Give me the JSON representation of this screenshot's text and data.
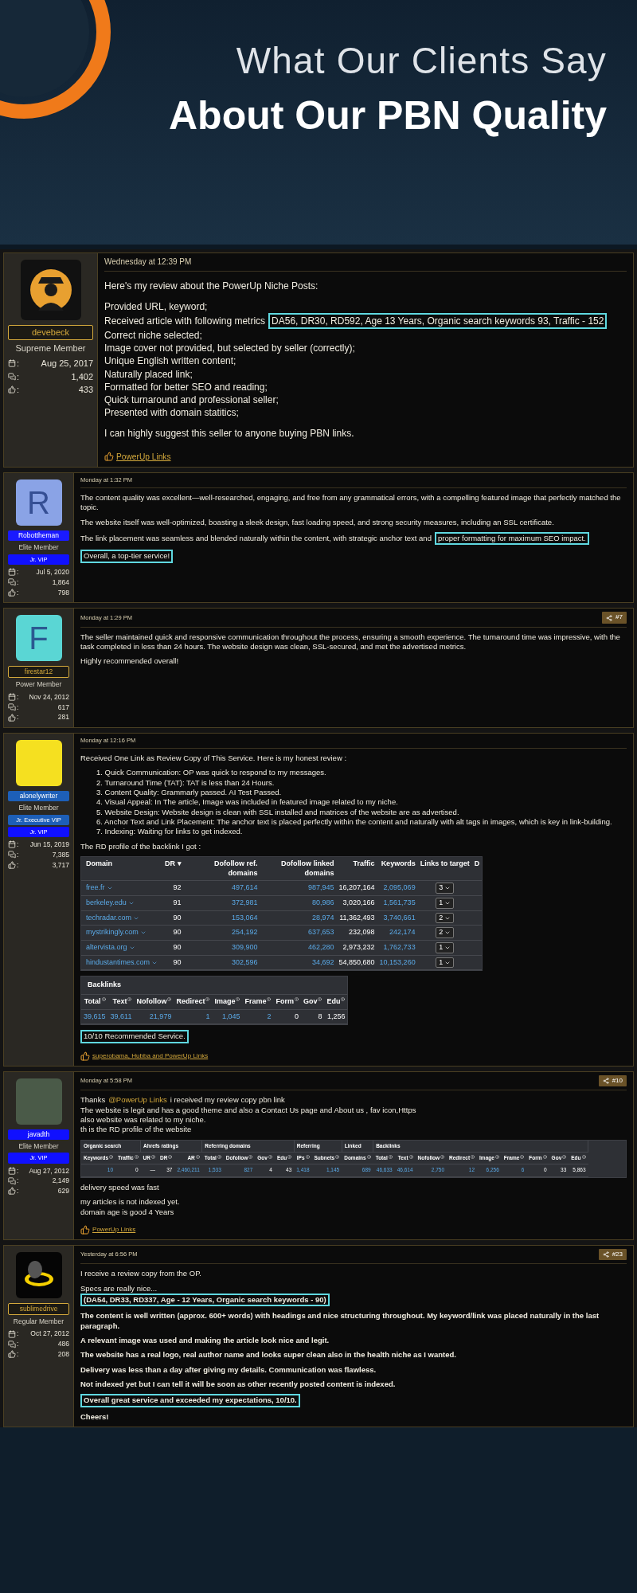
{
  "banner": {
    "line1": "What Our Clients Say",
    "line2": "About Our PBN Quality"
  },
  "posts": [
    {
      "user": {
        "avatar": {
          "kind": "silhouette",
          "color": "#111111"
        },
        "tag": {
          "text": "devebeck",
          "kind": "outlined",
          "color": "#d4a93c"
        },
        "role": "Supreme Member",
        "stats": [
          {
            "kind": "joined",
            "label": ":",
            "value": "Aug 25, 2017"
          },
          {
            "kind": "messages",
            "label": ":",
            "value": "1,402"
          },
          {
            "kind": "reactions",
            "label": ":",
            "value": "433"
          }
        ]
      },
      "date": "Wednesday at 12:39 PM",
      "blocks": [
        {
          "kind": "para",
          "lines": [
            {
              "bold": false,
              "parts": [
                {
                  "text": "Here's my review about the PowerUp Niche Posts:",
                  "kind": "plain"
                }
              ]
            }
          ]
        },
        {
          "kind": "para",
          "lines": [
            {
              "bold": false,
              "parts": [
                {
                  "text": "Provided URL, keyword;",
                  "kind": "plain"
                }
              ]
            },
            {
              "bold": false,
              "parts": [
                {
                  "text": "Received article with following metrics",
                  "kind": "plain"
                },
                {
                  "text": "DA56, DR30, RD592, Age 13 Years, Organic search keywords 93, Traffic - 152",
                  "kind": "boxed"
                }
              ]
            },
            {
              "bold": false,
              "parts": [
                {
                  "text": "Correct niche selected;",
                  "kind": "plain"
                }
              ]
            },
            {
              "bold": false,
              "parts": [
                {
                  "text": "Image cover not provided, but selected by seller (correctly);",
                  "kind": "plain"
                }
              ]
            },
            {
              "bold": false,
              "parts": [
                {
                  "text": "Unique English written content;",
                  "kind": "plain"
                }
              ]
            },
            {
              "bold": false,
              "parts": [
                {
                  "text": "Naturally placed link;",
                  "kind": "plain"
                }
              ]
            },
            {
              "bold": false,
              "parts": [
                {
                  "text": "Formatted for better SEO and reading;",
                  "kind": "plain"
                }
              ]
            },
            {
              "bold": false,
              "parts": [
                {
                  "text": "Quick turnaround and professional seller;",
                  "kind": "plain"
                }
              ]
            },
            {
              "bold": false,
              "parts": [
                {
                  "text": "Presented with domain statitics;",
                  "kind": "plain"
                }
              ]
            }
          ]
        },
        {
          "kind": "para",
          "lines": [
            {
              "bold": false,
              "parts": [
                {
                  "text": "I can highly suggest this seller to anyone buying PBN links.",
                  "kind": "plain"
                }
              ]
            }
          ]
        },
        {
          "kind": "likes",
          "text": "PowerUp Links"
        }
      ]
    },
    {
      "user": {
        "avatar": {
          "kind": "letter",
          "letter": "R",
          "color": "#8aa3e6"
        },
        "tag": {
          "text": "Robottheman",
          "kind": "filled",
          "color": "#1a1aff"
        },
        "role": "Elite Member",
        "badges": [
          {
            "text": "Jr. VIP",
            "color": "#1010ff"
          }
        ],
        "stats": [
          {
            "kind": "joined",
            "label": ":",
            "value": "Jul 5, 2020"
          },
          {
            "kind": "messages",
            "label": ":",
            "value": "1,864"
          },
          {
            "kind": "reactions",
            "label": ":",
            "value": "798"
          }
        ]
      },
      "date": "Monday at 1:32 PM",
      "blocks": [
        {
          "kind": "para",
          "lines": [
            {
              "bold": false,
              "parts": [
                {
                  "text": "The content quality was excellent—well-researched, engaging, and free from any grammatical errors, with a compelling featured image that perfectly matched the topic.",
                  "kind": "plain"
                }
              ]
            }
          ]
        },
        {
          "kind": "para",
          "lines": [
            {
              "bold": false,
              "parts": [
                {
                  "text": "The website itself was well-optimized, boasting a sleek design, fast loading speed, and strong security measures, including an SSL certificate.",
                  "kind": "plain"
                }
              ]
            }
          ]
        },
        {
          "kind": "para",
          "lines": [
            {
              "bold": false,
              "parts": [
                {
                  "text": "The link placement was seamless and blended naturally within the content, with strategic anchor text and",
                  "kind": "plain"
                },
                {
                  "text": "proper formatting for maximum SEO impact.",
                  "kind": "boxed"
                }
              ]
            }
          ]
        },
        {
          "kind": "para",
          "lines": [
            {
              "bold": false,
              "parts": [
                {
                  "text": "Overall, a top-tier service!",
                  "kind": "boxed"
                }
              ]
            }
          ]
        }
      ]
    },
    {
      "user": {
        "avatar": {
          "kind": "letter",
          "letter": "F",
          "color": "#5ad6d4"
        },
        "tag": {
          "text": "firestar12",
          "kind": "outlined",
          "color": "#d4a93c"
        },
        "role": "Power Member",
        "stats": [
          {
            "kind": "joined",
            "label": ":",
            "value": "Nov 24, 2012"
          },
          {
            "kind": "messages",
            "label": ":",
            "value": "617"
          },
          {
            "kind": "reactions",
            "label": ":",
            "value": "281"
          }
        ]
      },
      "date": "Monday at 1:29 PM",
      "number": "#7",
      "blocks": [
        {
          "kind": "para",
          "lines": [
            {
              "bold": false,
              "parts": [
                {
                  "text": "The seller maintained quick and responsive communication throughout the process, ensuring a smooth experience. The turnaround time was impressive, with the task completed in less than 24 hours. The website design was clean, SSL-secured, and met the advertised metrics.",
                  "kind": "plain"
                }
              ]
            }
          ]
        },
        {
          "kind": "para",
          "lines": [
            {
              "bold": false,
              "parts": [
                {
                  "text": "Highly recommended overall!",
                  "kind": "plain"
                }
              ]
            }
          ]
        }
      ]
    },
    {
      "user": {
        "avatar": {
          "kind": "photo",
          "color": "#f5e020"
        },
        "tag": {
          "text": "alonelywriter",
          "kind": "filled",
          "color": "#1d5fb8"
        },
        "role": "Elite Member",
        "badges": [
          {
            "text": "Jr. Executive VIP",
            "color": "#1d5fb8"
          },
          {
            "text": "Jr. VIP",
            "color": "#1010ff"
          }
        ],
        "stats": [
          {
            "kind": "joined",
            "label": ":",
            "value": "Jun 15, 2019"
          },
          {
            "kind": "messages",
            "label": ":",
            "value": "7,385"
          },
          {
            "kind": "reactions",
            "label": ":",
            "value": "3,717"
          }
        ]
      },
      "date": "Monday at 12:16 PM",
      "blocks": [
        {
          "kind": "para",
          "lines": [
            {
              "bold": false,
              "parts": [
                {
                  "text": "Received One Link as Review Copy of This Service. Here is my honest review :",
                  "kind": "plain"
                }
              ]
            }
          ]
        },
        {
          "kind": "list",
          "items": [
            "1. Quick Communication: OP was quick to respond to my messages.",
            "2. Turnaround Time (TAT): TAT is less than 24 Hours.",
            "3. Content Quality: Grammarly passed. AI Test Passed.",
            "4. Visual Appeal: In The article, Image was included in featured image related to my niche.",
            "5. Website Design: Website design is clean with SSL installed and matrices of the website are as advertised.",
            "6. Anchor Text and Link Placement: The anchor text is placed perfectly within the content and naturally with alt tags in images, which is key in link-building.",
            "7. Indexing: Waiting for links to get indexed."
          ]
        },
        {
          "kind": "para",
          "lines": [
            {
              "bold": false,
              "parts": [
                {
                  "text": "The RD profile of the backlink I got :",
                  "kind": "plain"
                }
              ]
            }
          ]
        },
        {
          "kind": "table",
          "info_marks": false,
          "columns": [
            "Domain",
            "DR ▾",
            "Dofollow ref. domains",
            "Dofollow linked domains",
            "Traffic",
            "Keywords",
            "Links to target",
            "D"
          ],
          "rows": [
            [
              {
                "text": "free.fr",
                "kind": "domain"
              },
              {
                "text": "92",
                "kind": "plain"
              },
              {
                "text": "497,614",
                "kind": "link"
              },
              {
                "text": "987,945",
                "kind": "link"
              },
              {
                "text": "16,207,164",
                "kind": "plain"
              },
              {
                "text": "2,095,069",
                "kind": "link"
              },
              {
                "text": "3",
                "kind": "select"
              }
            ],
            [
              {
                "text": "berkeley.edu",
                "kind": "domain"
              },
              {
                "text": "91",
                "kind": "plain"
              },
              {
                "text": "372,981",
                "kind": "link"
              },
              {
                "text": "80,986",
                "kind": "link"
              },
              {
                "text": "3,020,166",
                "kind": "plain"
              },
              {
                "text": "1,561,735",
                "kind": "link"
              },
              {
                "text": "1",
                "kind": "select"
              }
            ],
            [
              {
                "text": "techradar.com",
                "kind": "domain"
              },
              {
                "text": "90",
                "kind": "plain"
              },
              {
                "text": "153,064",
                "kind": "link"
              },
              {
                "text": "28,974",
                "kind": "link"
              },
              {
                "text": "11,362,493",
                "kind": "plain"
              },
              {
                "text": "3,740,661",
                "kind": "link"
              },
              {
                "text": "2",
                "kind": "select"
              }
            ],
            [
              {
                "text": "mystrikingly.com",
                "kind": "domain"
              },
              {
                "text": "90",
                "kind": "plain"
              },
              {
                "text": "254,192",
                "kind": "link"
              },
              {
                "text": "637,653",
                "kind": "link"
              },
              {
                "text": "232,098",
                "kind": "plain"
              },
              {
                "text": "242,174",
                "kind": "link"
              },
              {
                "text": "2",
                "kind": "select"
              }
            ],
            [
              {
                "text": "altervista.org",
                "kind": "domain"
              },
              {
                "text": "90",
                "kind": "plain"
              },
              {
                "text": "309,900",
                "kind": "link"
              },
              {
                "text": "462,280",
                "kind": "link"
              },
              {
                "text": "2,973,232",
                "kind": "plain"
              },
              {
                "text": "1,762,733",
                "kind": "link"
              },
              {
                "text": "1",
                "kind": "select"
              }
            ],
            [
              {
                "text": "hindustantimes.com",
                "kind": "domain"
              },
              {
                "text": "90",
                "kind": "plain"
              },
              {
                "text": "302,596",
                "kind": "link"
              },
              {
                "text": "34,692",
                "kind": "link"
              },
              {
                "text": "54,850,680",
                "kind": "plain"
              },
              {
                "text": "10,153,260",
                "kind": "link"
              },
              {
                "text": "1",
                "kind": "select"
              }
            ]
          ]
        },
        {
          "kind": "table",
          "title": "Backlinks",
          "info_marks": true,
          "columns": [
            "Total",
            "Text",
            "Nofollow",
            "Redirect",
            "Image",
            "Frame",
            "Form",
            "Gov",
            "Edu"
          ],
          "rows": [
            [
              {
                "text": "39,615",
                "kind": "link"
              },
              {
                "text": "39,611",
                "kind": "link"
              },
              {
                "text": "21,979",
                "kind": "link"
              },
              {
                "text": "1",
                "kind": "link"
              },
              {
                "text": "1,045",
                "kind": "link"
              },
              {
                "text": "2",
                "kind": "link"
              },
              {
                "text": "0",
                "kind": "plain"
              },
              {
                "text": "8",
                "kind": "plain"
              },
              {
                "text": "1,256",
                "kind": "plain"
              }
            ]
          ]
        },
        {
          "kind": "para",
          "lines": [
            {
              "bold": false,
              "parts": [
                {
                  "text": "10/10 Recommended Service.",
                  "kind": "boxed"
                }
              ]
            }
          ]
        },
        {
          "kind": "likes",
          "text": "superobama, Hubba and PowerUp Links"
        }
      ]
    },
    {
      "user": {
        "avatar": {
          "kind": "photo",
          "color": "#4a5a48"
        },
        "tag": {
          "text": "javadth",
          "kind": "filled",
          "color": "#1010ff"
        },
        "role": "Elite Member",
        "badges": [
          {
            "text": "Jr. VIP",
            "color": "#1010ff"
          }
        ],
        "stats": [
          {
            "kind": "joined",
            "label": ":",
            "value": "Aug 27, 2012"
          },
          {
            "kind": "messages",
            "label": ":",
            "value": "2,149"
          },
          {
            "kind": "reactions",
            "label": ":",
            "value": "629"
          }
        ]
      },
      "date": "Monday at 5:58 PM",
      "number": "#10",
      "blocks": [
        {
          "kind": "para",
          "lines": [
            {
              "bold": false,
              "parts": [
                {
                  "text": "Thanks",
                  "kind": "plain"
                },
                {
                  "text": "@PowerUp Links",
                  "kind": "mention"
                },
                {
                  "text": "i received my review copy pbn link",
                  "kind": "plain"
                }
              ]
            },
            {
              "bold": false,
              "parts": [
                {
                  "text": "The website is legit and has a good theme and also a Contact Us page and About us , fav icon,Https",
                  "kind": "plain"
                }
              ]
            },
            {
              "bold": false,
              "parts": [
                {
                  "text": "also website was related to my niche.",
                  "kind": "plain"
                }
              ]
            },
            {
              "bold": false,
              "parts": [
                {
                  "text": "th is the RD profile of the website",
                  "kind": "plain"
                }
              ]
            }
          ]
        },
        {
          "kind": "table",
          "info_marks": true,
          "groups": [
            {
              "label": "Organic search",
              "columns": [
                "Keywords",
                "Traffic"
              ]
            },
            {
              "label": "Ahrefs ratings",
              "columns": [
                "UR",
                "DR",
                "AR"
              ]
            },
            {
              "label": "Referring domains",
              "columns": [
                "Total",
                "Dofollow",
                "Gov",
                "Edu"
              ]
            },
            {
              "label": "Referring",
              "columns": [
                "IPs",
                "Subnets"
              ]
            },
            {
              "label": "Linked",
              "columns": [
                "Domains"
              ]
            },
            {
              "label": "Backlinks",
              "columns": [
                "Total",
                "Text",
                "Nofollow",
                "Redirect",
                "Image",
                "Frame",
                "Form",
                "Gov",
                "Edu"
              ]
            }
          ],
          "rows": [
            [
              {
                "text": "10",
                "kind": "link"
              },
              {
                "text": "0",
                "kind": "plain"
              },
              {
                "text": "—",
                "kind": "plain"
              },
              {
                "text": "37",
                "kind": "plain"
              },
              {
                "text": "2,460,211",
                "kind": "link"
              },
              {
                "text": "1,533",
                "kind": "link"
              },
              {
                "text": "827",
                "kind": "link"
              },
              {
                "text": "4",
                "kind": "plain"
              },
              {
                "text": "43",
                "kind": "plain"
              },
              {
                "text": "1,418",
                "kind": "link"
              },
              {
                "text": "1,145",
                "kind": "link"
              },
              {
                "text": "689",
                "kind": "link"
              },
              {
                "text": "46,633",
                "kind": "link"
              },
              {
                "text": "46,614",
                "kind": "link"
              },
              {
                "text": "2,750",
                "kind": "link"
              },
              {
                "text": "12",
                "kind": "link"
              },
              {
                "text": "6,256",
                "kind": "link"
              },
              {
                "text": "6",
                "kind": "link"
              },
              {
                "text": "0",
                "kind": "plain"
              },
              {
                "text": "33",
                "kind": "plain"
              },
              {
                "text": "5,863",
                "kind": "plain"
              }
            ]
          ]
        },
        {
          "kind": "para",
          "lines": [
            {
              "bold": false,
              "parts": [
                {
                  "text": "delivery speed was fast",
                  "kind": "plain"
                }
              ]
            }
          ]
        },
        {
          "kind": "para",
          "lines": [
            {
              "bold": false,
              "parts": [
                {
                  "text": "my articles is not indexed yet.",
                  "kind": "plain"
                }
              ]
            },
            {
              "bold": false,
              "parts": [
                {
                  "text": "domain age is good 4 Years",
                  "kind": "plain"
                }
              ]
            }
          ]
        },
        {
          "kind": "likes",
          "text": "PowerUp Links"
        }
      ]
    },
    {
      "user": {
        "avatar": {
          "kind": "ring",
          "color": "#f5d000"
        },
        "tag": {
          "text": "sublimedrive",
          "kind": "outlined",
          "color": "#d4a93c"
        },
        "role": "Regular Member",
        "stats": [
          {
            "kind": "joined",
            "label": ":",
            "value": "Oct 27, 2012"
          },
          {
            "kind": "messages",
            "label": ":",
            "value": "486"
          },
          {
            "kind": "reactions",
            "label": ":",
            "value": "208"
          }
        ]
      },
      "date": "Yesterday at 6:56 PM",
      "number": "#23",
      "blocks": [
        {
          "kind": "para",
          "lines": [
            {
              "bold": false,
              "parts": [
                {
                  "text": "I receive a review copy from the OP.",
                  "kind": "plain"
                }
              ]
            }
          ]
        },
        {
          "kind": "para",
          "lines": [
            {
              "bold": false,
              "parts": [
                {
                  "text": "Specs are really nice...",
                  "kind": "plain"
                }
              ]
            },
            {
              "bold": true,
              "parts": [
                {
                  "text": "(DA54, DR33, RD337, Age - 12 Years, Organic search keywords - 90)",
                  "kind": "boxed"
                }
              ]
            }
          ]
        },
        {
          "kind": "para",
          "lines": [
            {
              "bold": true,
              "parts": [
                {
                  "text": "The content is well written (approx. 600+ words) with headings and nice structuring throughout. My keyword/link was placed naturally in the last paragraph.",
                  "kind": "plain"
                }
              ]
            }
          ]
        },
        {
          "kind": "para",
          "lines": [
            {
              "bold": true,
              "parts": [
                {
                  "text": "A relevant image was used and making the article look nice and legit.",
                  "kind": "plain"
                }
              ]
            }
          ]
        },
        {
          "kind": "para",
          "lines": [
            {
              "bold": true,
              "parts": [
                {
                  "text": "The website has a real logo, real author name and looks super clean also in the health niche as I wanted.",
                  "kind": "plain"
                }
              ]
            }
          ]
        },
        {
          "kind": "para",
          "lines": [
            {
              "bold": true,
              "parts": [
                {
                  "text": "Delivery was less than a day after giving my details. Communication was flawless.",
                  "kind": "plain"
                }
              ]
            }
          ]
        },
        {
          "kind": "para",
          "lines": [
            {
              "bold": true,
              "parts": [
                {
                  "text": "Not indexed yet but I can tell it will be soon as other recently posted content is indexed.",
                  "kind": "plain"
                }
              ]
            }
          ]
        },
        {
          "kind": "para",
          "lines": [
            {
              "bold": true,
              "parts": [
                {
                  "text": "Overall great service and exceeded my expectations, 10/10.",
                  "kind": "boxed"
                }
              ]
            }
          ]
        },
        {
          "kind": "para",
          "lines": [
            {
              "bold": true,
              "parts": [
                {
                  "text": "Cheers!",
                  "kind": "plain"
                }
              ]
            }
          ]
        }
      ]
    }
  ]
}
